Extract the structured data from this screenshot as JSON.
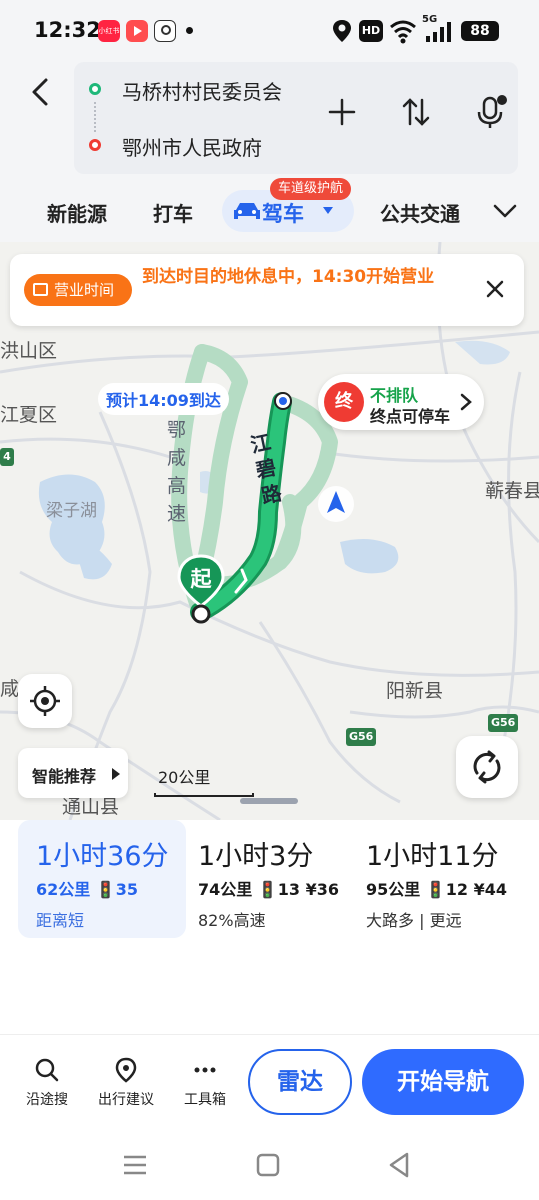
{
  "status_bar": {
    "time": "12:32",
    "battery": "88",
    "network": "5G",
    "hd_badge": "HD",
    "apps": [
      {
        "name": "xiaohongshu-app-icon",
        "label": "小红书",
        "color": "#ff2442"
      },
      {
        "name": "video-app-icon",
        "label": "",
        "color": "#ff4d4f"
      },
      {
        "name": "mini-app-icon",
        "label": "",
        "color": "#333333"
      }
    ]
  },
  "header": {
    "origin": "马桥村村民委员会",
    "destination": "鄂州市人民政府",
    "origin_color": "#1fb87a",
    "destination_color": "#ef3b33"
  },
  "tabs": {
    "items": [
      "新能源",
      "打车",
      "驾车",
      "公共交通"
    ],
    "active": "驾车",
    "badge": "车道级护航",
    "accent": "#2563eb"
  },
  "map": {
    "notice": {
      "tag": "营业时间",
      "text": "到达时目的地休息中，14:30开始营业"
    },
    "eta_label": "预计14:09到达",
    "destination_card": {
      "badge": "终",
      "line1": "不排队",
      "line2": "终点可停车"
    },
    "start_badge": "起",
    "labels": {
      "hongshan": "洪山区",
      "jiangxia": "江夏区",
      "liangzihu": "梁子湖",
      "qichun": "蕲春县",
      "yangxin": "阳新县",
      "tongshan": "通山县",
      "xianning_partial": "咸",
      "expressway": "鄂咸高速",
      "road": "江碧路",
      "g56_a": "G56",
      "g56_b": "G56",
      "shield_4": "4"
    },
    "recommend": "智能推荐",
    "scale": "20公里"
  },
  "routes": [
    {
      "time": "1小时36分",
      "distance": "62公里",
      "lights": "35",
      "toll": "",
      "tag": "距离短",
      "selected": true
    },
    {
      "time": "1小时3分",
      "distance": "74公里",
      "lights": "13",
      "toll": "¥36",
      "tag": "82%高速",
      "selected": false
    },
    {
      "time": "1小时11分",
      "distance": "95公里",
      "lights": "12",
      "toll": "¥44",
      "tag": "大路多 | 更远",
      "selected": false
    }
  ],
  "bottom_bar": {
    "tools": [
      "沿途搜",
      "出行建议",
      "工具箱"
    ],
    "radar": "雷达",
    "start": "开始导航"
  }
}
